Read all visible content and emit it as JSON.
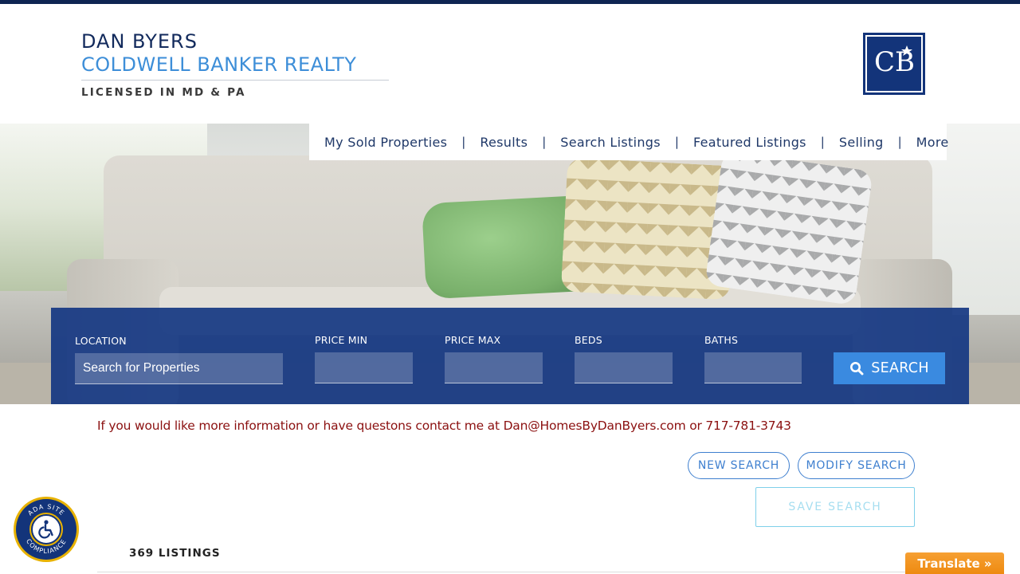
{
  "brand": {
    "name": "DAN BYERS",
    "company": "COLDWELL BANKER REALTY",
    "license": "LICENSED IN MD & PA",
    "logo_text": "CB"
  },
  "nav": {
    "items": [
      "My Sold Properties",
      "Results",
      "Search Listings",
      "Featured Listings",
      "Selling",
      "More"
    ],
    "separator": "|"
  },
  "search": {
    "location_label": "LOCATION",
    "location_placeholder": "Search for Properties",
    "price_min_label": "PRICE MIN",
    "price_max_label": "PRICE MAX",
    "beds_label": "BEDS",
    "baths_label": "BATHS",
    "button_label": "SEARCH",
    "button_icon": "search-icon"
  },
  "contact": {
    "text": "If you would like more information or have questons contact me at Dan@HomesByDanByers.com or 717-781-3743"
  },
  "actions": {
    "new_search": "NEW SEARCH",
    "modify_search": "MODIFY SEARCH",
    "save_search": "SAVE SEARCH"
  },
  "results": {
    "count_label": "369 LISTINGS"
  },
  "ada": {
    "top_text": "ADA SITE",
    "bottom_text": "COMPLIANCE",
    "icon": "wheelchair-icon"
  },
  "translate": {
    "label": "Translate »"
  },
  "colors": {
    "navy": "#13347a",
    "accent_blue": "#3a8ae0",
    "contact_red": "#8b1010",
    "translate_orange": "#ee8a10"
  }
}
